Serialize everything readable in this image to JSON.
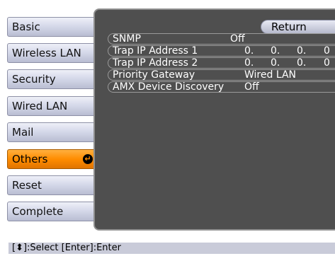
{
  "sidebar": {
    "items": [
      {
        "label": "Basic"
      },
      {
        "label": "Wireless LAN"
      },
      {
        "label": "Security"
      },
      {
        "label": "Wired LAN"
      },
      {
        "label": "Mail"
      },
      {
        "label": "Others",
        "active": true
      },
      {
        "label": "Reset"
      },
      {
        "label": "Complete"
      }
    ],
    "active_indicator": "enter-arrow-icon"
  },
  "panel": {
    "return_label": "Return",
    "rows": [
      {
        "label": "SNMP",
        "value": "Off"
      },
      {
        "label": "Trap IP Address 1",
        "octets": [
          "0.",
          "0.",
          "0.",
          "0"
        ]
      },
      {
        "label": "Trap IP Address 2",
        "octets": [
          "0.",
          "0.",
          "0.",
          "0"
        ]
      },
      {
        "label": "Priority Gateway",
        "value": "Wired LAN"
      },
      {
        "label": "AMX Device Discovery",
        "value": "Off"
      }
    ]
  },
  "statusbar": {
    "text": "[⬍]:Select  [Enter]:Enter"
  },
  "colors": {
    "panel_bg": "#4f4f4f",
    "active_tab": "#ff8c00",
    "tab": "#d6d9ea",
    "status_bg": "#c9cbd9"
  }
}
